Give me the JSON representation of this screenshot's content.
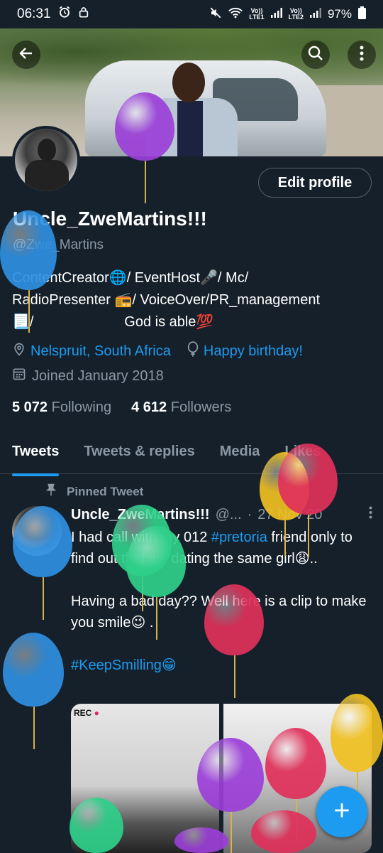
{
  "status_bar": {
    "time": "06:31",
    "sim1": "LTE1",
    "sim2": "LTE2",
    "vo": "Vo))",
    "battery": "97%"
  },
  "profile": {
    "display_name": "Uncle_ZweMartins!!!",
    "handle": "@Zwe_Martins",
    "edit_label": "Edit profile",
    "bio_lines": [
      "ContentCreator🌐/ EventHost🎤/ Mc/",
      "RadioPresenter 📻/ VoiceOver/PR_management",
      "📃/                       God is able💯"
    ],
    "location": "Nelspruit, South Africa",
    "birthday": "Happy birthday!",
    "joined": "Joined January 2018",
    "following_count": "5 072",
    "following_label": "Following",
    "followers_count": "4 612",
    "followers_label": "Followers"
  },
  "tabs": [
    {
      "label": "Tweets"
    },
    {
      "label": "Tweets & replies"
    },
    {
      "label": "Media"
    },
    {
      "label": "Likes"
    }
  ],
  "tweet": {
    "pinned_label": "Pinned Tweet",
    "name": "Uncle_ZweMartins!!!",
    "handle": "@...",
    "date": "27 Nov 20",
    "line1_pre": "I had call with my 012 ",
    "line1_tag": "#pretoria",
    "line1_post": " friend only to find out that we dating the same girl😩..",
    "para2": "Having a bad day?? Well here is a clip to make you smile😉 .",
    "hashtag": "#KeepSmilling😁",
    "media_rec": "REC"
  },
  "colors": {
    "background": "#15202b",
    "accent": "#1d9bf0",
    "muted": "#8b98a5",
    "balloon_purple": "#9b3fd8",
    "balloon_blue": "#2f8fe0",
    "balloon_green": "#2fd08a",
    "balloon_red": "#e0305a",
    "balloon_yellow": "#f0c020"
  },
  "icons": {
    "back": "arrow-left-icon",
    "search": "search-icon",
    "more": "more-vertical-icon",
    "location": "location-pin-icon",
    "birthday": "balloon-icon",
    "calendar": "calendar-icon",
    "pin": "pin-icon",
    "compose": "plus-icon"
  }
}
